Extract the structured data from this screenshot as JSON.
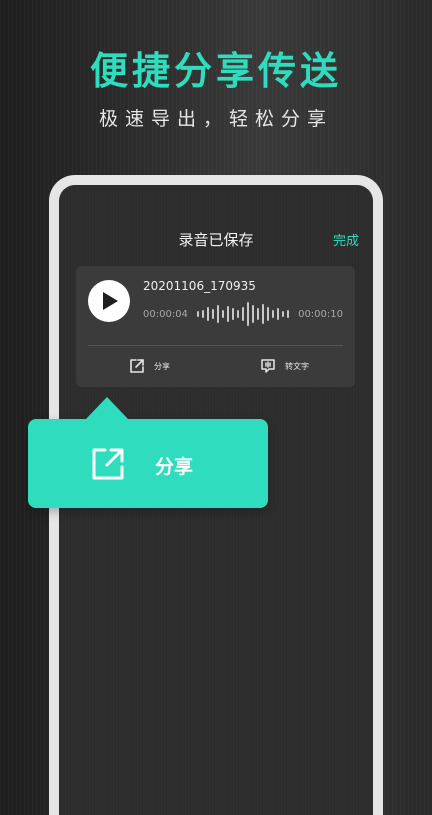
{
  "headline": "便捷分享传送",
  "subline": "极速导出，轻松分享",
  "app": {
    "title": "录音已保存",
    "done_label": "完成"
  },
  "recording": {
    "file_name": "20201106_170935",
    "time_current": "00:00:04",
    "time_total": "00:00:10",
    "actions": {
      "share_label": "分享",
      "to_text_label": "转文字"
    }
  },
  "callout": {
    "label": "分享"
  },
  "colors": {
    "accent": "#2fdcbd",
    "card": "#3b3b3b",
    "phone_bezel": "#e6e6e6"
  },
  "icons": {
    "play": "play-icon",
    "share": "share-icon",
    "to_text": "speech-to-text-icon",
    "waveform": "waveform-icon"
  }
}
